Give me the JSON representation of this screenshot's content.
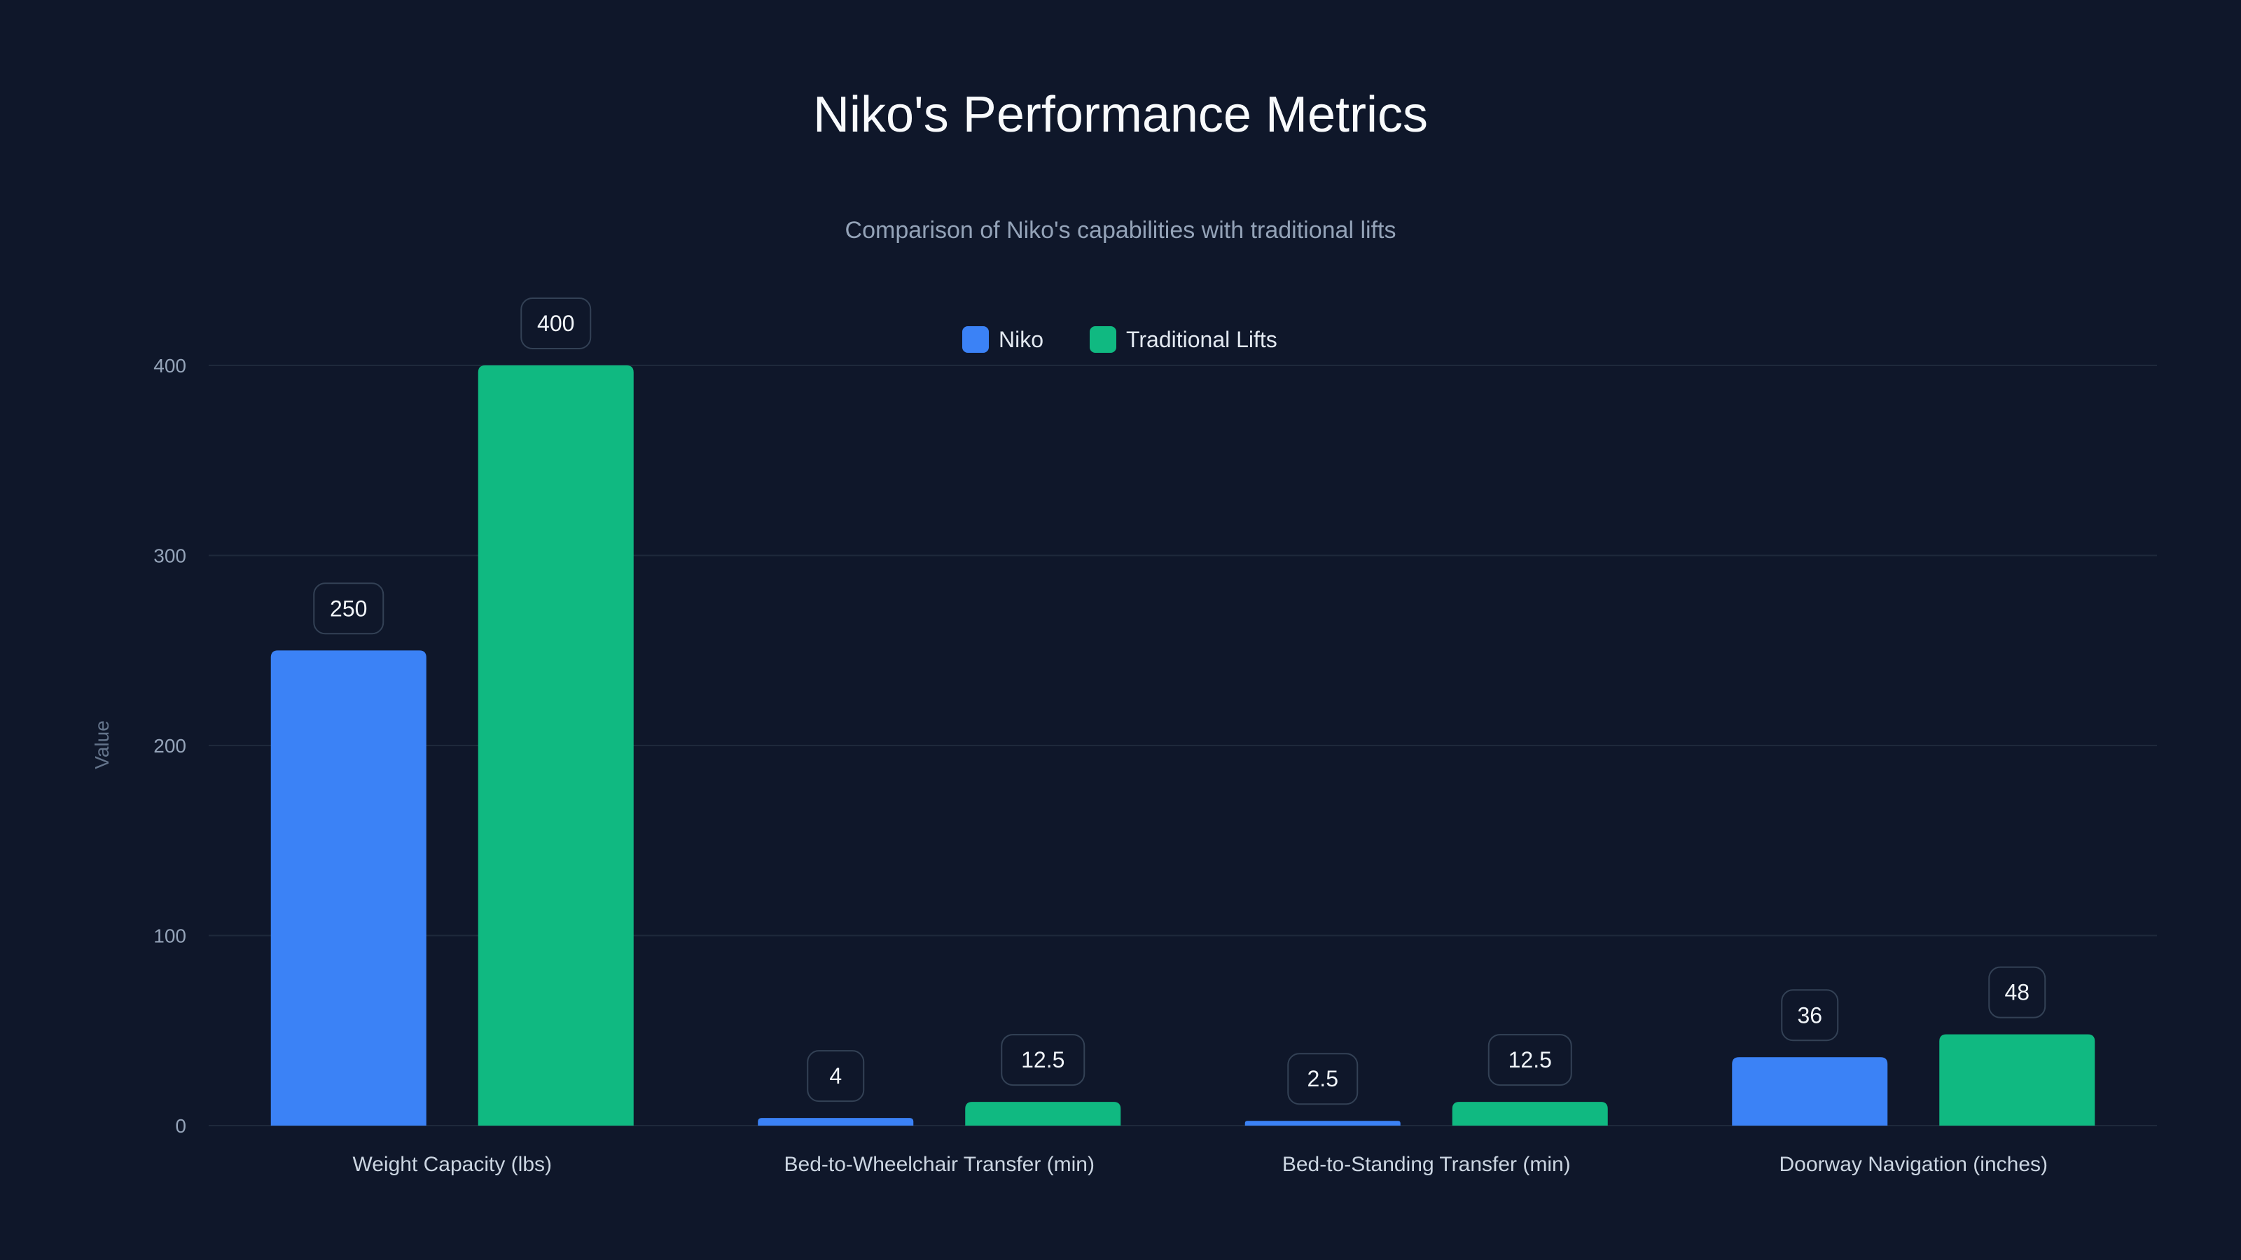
{
  "chart_data": {
    "type": "bar",
    "title": "Niko's Performance Metrics",
    "subtitle": "Comparison of Niko's capabilities with traditional lifts",
    "xlabel": "",
    "ylabel": "Value",
    "ylim": [
      0,
      400
    ],
    "yticks": [
      0,
      100,
      200,
      300,
      400
    ],
    "grid": true,
    "legend_position": "top-center",
    "categories": [
      "Weight Capacity (lbs)",
      "Bed-to-Wheelchair Transfer (min)",
      "Bed-to-Standing Transfer (min)",
      "Doorway Navigation (inches)"
    ],
    "series": [
      {
        "name": "Niko",
        "color": "#3b82f6",
        "values": [
          250,
          4,
          2.5,
          36
        ]
      },
      {
        "name": "Traditional Lifts",
        "color": "#10b981",
        "values": [
          400,
          12.5,
          12.5,
          48
        ]
      }
    ]
  }
}
